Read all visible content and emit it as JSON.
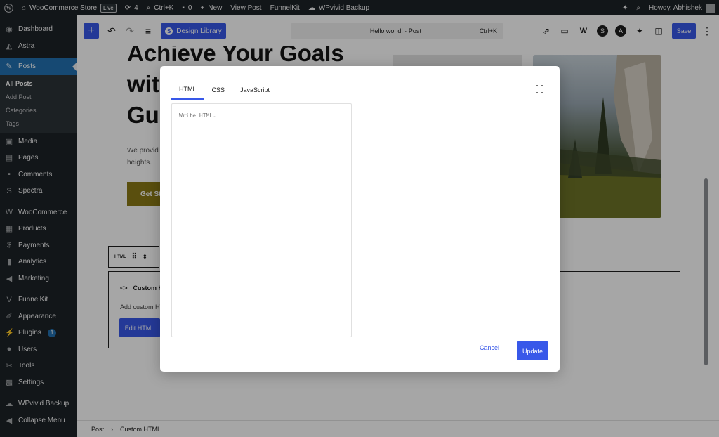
{
  "adminbar": {
    "site_name": "WooCommerce Store",
    "live_badge": "Live",
    "updates_count": "4",
    "search_shortcut": "Ctrl+K",
    "comments_count": "0",
    "new_label": "New",
    "view_post": "View Post",
    "funnelkit": "FunnelKit",
    "wpvivid": "WPvivid Backup",
    "howdy": "Howdy, Abhishek"
  },
  "sidebar": {
    "items": [
      {
        "label": "Dashboard",
        "icon": "dashboard-icon"
      },
      {
        "label": "Astra",
        "icon": "astra-icon"
      },
      {
        "label": "Posts",
        "icon": "pin-icon"
      },
      {
        "label": "Media",
        "icon": "media-icon"
      },
      {
        "label": "Pages",
        "icon": "pages-icon"
      },
      {
        "label": "Comments",
        "icon": "comments-icon"
      },
      {
        "label": "Spectra",
        "icon": "spectra-icon"
      },
      {
        "label": "WooCommerce",
        "icon": "woo-icon"
      },
      {
        "label": "Products",
        "icon": "products-icon"
      },
      {
        "label": "Payments",
        "icon": "payments-icon"
      },
      {
        "label": "Analytics",
        "icon": "analytics-icon"
      },
      {
        "label": "Marketing",
        "icon": "marketing-icon"
      },
      {
        "label": "FunnelKit",
        "icon": "funnelkit-icon"
      },
      {
        "label": "Appearance",
        "icon": "appearance-icon"
      },
      {
        "label": "Plugins",
        "icon": "plugins-icon",
        "badge": "1"
      },
      {
        "label": "Users",
        "icon": "users-icon"
      },
      {
        "label": "Tools",
        "icon": "tools-icon"
      },
      {
        "label": "Settings",
        "icon": "settings-icon"
      },
      {
        "label": "WPvivid Backup",
        "icon": "backup-icon"
      },
      {
        "label": "Collapse Menu",
        "icon": "collapse-icon"
      }
    ],
    "posts_sub": [
      "All Posts",
      "Add Post",
      "Categories",
      "Tags"
    ]
  },
  "toolbar": {
    "design_library": "Design Library",
    "command_title": "Hello world! · Post",
    "command_shortcut": "Ctrl+K",
    "save": "Save"
  },
  "canvas": {
    "hero_line1": "Achieve Your Goals",
    "hero_line2": "wit",
    "hero_line3": "Gu",
    "hero_desc": "We provid heights.",
    "hero_cta": "Get St",
    "block_type": "HTML",
    "html_block_label": "Custom H",
    "html_block_desc": "Add custom HT",
    "edit_html": "Edit HTML"
  },
  "modal": {
    "tabs": [
      "HTML",
      "CSS",
      "JavaScript"
    ],
    "active_tab": "HTML",
    "placeholder": "Write HTML…",
    "cancel": "Cancel",
    "update": "Update"
  },
  "breadcrumb": {
    "root": "Post",
    "current": "Custom HTML"
  },
  "colors": {
    "accent": "#3858e9",
    "admin_bg": "#1d2327",
    "active_menu": "#2271b1"
  }
}
